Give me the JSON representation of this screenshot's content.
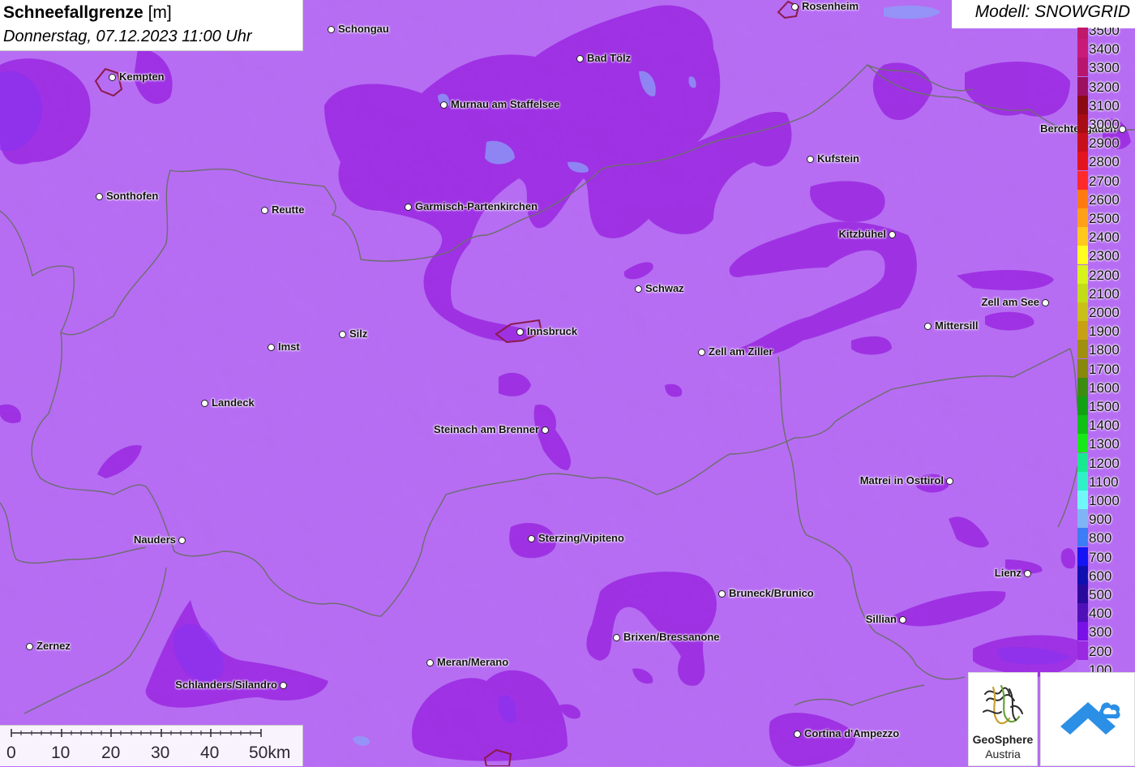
{
  "title": {
    "parameter": "Schneefallgrenze",
    "unit": "[m]",
    "datetime": "Donnerstag, 07.12.2023 11:00 Uhr"
  },
  "model_label": "Modell: SNOWGRID",
  "legend": [
    {
      "label": "3500",
      "color": "#c0186a"
    },
    {
      "label": "3400",
      "color": "#c81a78"
    },
    {
      "label": "3300",
      "color": "#b8166e"
    },
    {
      "label": "3200",
      "color": "#9c1060"
    },
    {
      "label": "3100",
      "color": "#8c0a14"
    },
    {
      "label": "3000",
      "color": "#a80c14"
    },
    {
      "label": "2900",
      "color": "#c8101c"
    },
    {
      "label": "2800",
      "color": "#e4141e"
    },
    {
      "label": "2700",
      "color": "#ff2a2a"
    },
    {
      "label": "2600",
      "color": "#ff7a10"
    },
    {
      "label": "2500",
      "color": "#ffa018"
    },
    {
      "label": "2400",
      "color": "#ffc81c"
    },
    {
      "label": "2300",
      "color": "#ffff20"
    },
    {
      "label": "2200",
      "color": "#d8f21c"
    },
    {
      "label": "2100",
      "color": "#c2dc18"
    },
    {
      "label": "2000",
      "color": "#c8c018"
    },
    {
      "label": "1900",
      "color": "#c8a014"
    },
    {
      "label": "1800",
      "color": "#a09010"
    },
    {
      "label": "1700",
      "color": "#88880c"
    },
    {
      "label": "1600",
      "color": "#3c8c10"
    },
    {
      "label": "1500",
      "color": "#14a014"
    },
    {
      "label": "1400",
      "color": "#10c014"
    },
    {
      "label": "1300",
      "color": "#18e818"
    },
    {
      "label": "1200",
      "color": "#18e890"
    },
    {
      "label": "1100",
      "color": "#30f0c8"
    },
    {
      "label": "1000",
      "color": "#70f8f8"
    },
    {
      "label": "900",
      "color": "#80b4f4"
    },
    {
      "label": "800",
      "color": "#3c7cf4"
    },
    {
      "label": "700",
      "color": "#1414f4"
    },
    {
      "label": "600",
      "color": "#1010b0"
    },
    {
      "label": "500",
      "color": "#2a0a9c"
    },
    {
      "label": "400",
      "color": "#5010b8"
    },
    {
      "label": "300",
      "color": "#7a10e8"
    },
    {
      "label": "200",
      "color": "#9a28e0"
    },
    {
      "label": "100",
      "color": "#b86ef5"
    }
  ],
  "cities": [
    {
      "name": "Rosenheim",
      "label_side": "right"
    },
    {
      "name": "Schongau",
      "label_side": "right"
    },
    {
      "name": "Kempten",
      "label_side": "right"
    },
    {
      "name": "Bad Tölz",
      "label_side": "right"
    },
    {
      "name": "Murnau am Staffelsee",
      "label_side": "right"
    },
    {
      "name": "Berchtesgaden",
      "label_side": "left"
    },
    {
      "name": "Kufstein",
      "label_side": "right"
    },
    {
      "name": "Sonthofen",
      "label_side": "right"
    },
    {
      "name": "Reutte",
      "label_side": "right"
    },
    {
      "name": "Garmisch-Partenkirchen",
      "label_side": "right"
    },
    {
      "name": "Kitzbühel",
      "label_side": "left"
    },
    {
      "name": "Schwaz",
      "label_side": "right"
    },
    {
      "name": "Zell am See",
      "label_side": "left"
    },
    {
      "name": "Mittersill",
      "label_side": "right"
    },
    {
      "name": "Silz",
      "label_side": "right"
    },
    {
      "name": "Imst",
      "label_side": "right"
    },
    {
      "name": "Innsbruck",
      "label_side": "right"
    },
    {
      "name": "Zell am Ziller",
      "label_side": "right"
    },
    {
      "name": "Landeck",
      "label_side": "right"
    },
    {
      "name": "Steinach am Brenner",
      "label_side": "left"
    },
    {
      "name": "Matrei in Osttirol",
      "label_side": "left"
    },
    {
      "name": "Nauders",
      "label_side": "left"
    },
    {
      "name": "Sterzing/Vipiteno",
      "label_side": "right"
    },
    {
      "name": "Lienz",
      "label_side": "left"
    },
    {
      "name": "Bruneck/Brunico",
      "label_side": "right"
    },
    {
      "name": "Sillian",
      "label_side": "left"
    },
    {
      "name": "Brixen/Bressanone",
      "label_side": "right"
    },
    {
      "name": "Zernez",
      "label_side": "right"
    },
    {
      "name": "Meran/Merano",
      "label_side": "right"
    },
    {
      "name": "Schlanders/Silandro",
      "label_side": "left"
    },
    {
      "name": "Cortina d'Ampezzo",
      "label_side": "right"
    }
  ],
  "scale_bar": {
    "labels": [
      "0",
      "10",
      "20",
      "30",
      "40",
      "50km"
    ]
  },
  "logos": {
    "geosphere_line1": "GeoSphere",
    "geosphere_line2": "Austria"
  },
  "colors": {
    "background_100": "#b86ef5",
    "area_200": "#9a28e0",
    "area_300": "#8a30f0",
    "border": "#6d6d6d",
    "lake": "#8aa0f8"
  }
}
